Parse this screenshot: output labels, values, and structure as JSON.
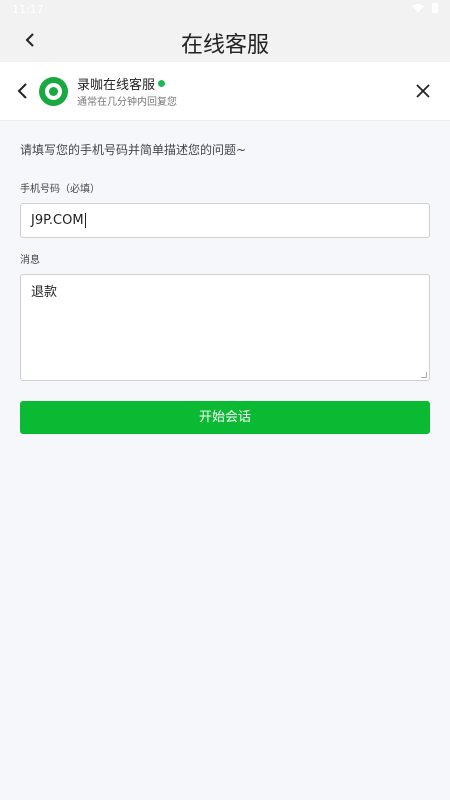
{
  "status_bar": {
    "time": "11:17"
  },
  "app_header": {
    "title": "在线客服"
  },
  "chat_header": {
    "name": "录咖在线客服",
    "subtitle": "通常在几分钟内回复您"
  },
  "form": {
    "prompt": "请填写您的手机号码并简单描述您的问题~",
    "phone_label": "手机号码（必填）",
    "phone_value": "J9P.COM",
    "message_label": "消息",
    "message_value": "退款",
    "submit_label": "开始会话"
  },
  "colors": {
    "accent": "#0bba33",
    "online": "#1db954",
    "logo": "#1aa940"
  }
}
